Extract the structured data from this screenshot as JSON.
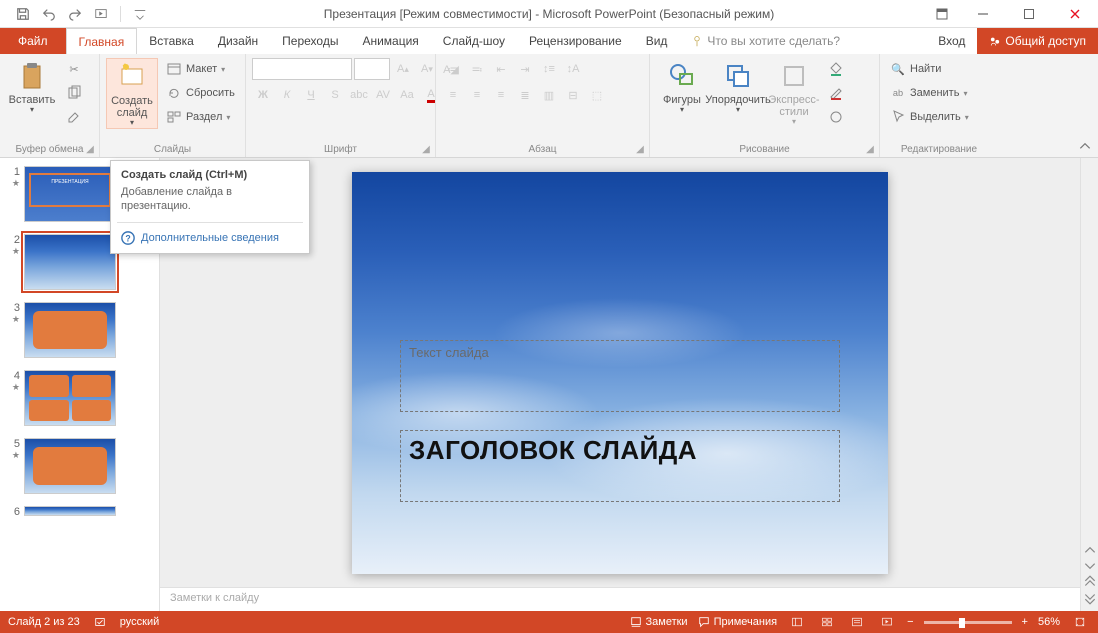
{
  "titlebar": {
    "title": "Презентация [Режим совместимости] - Microsoft PowerPoint (Безопасный режим)"
  },
  "tabs": {
    "file": "Файл",
    "home": "Главная",
    "insert": "Вставка",
    "design": "Дизайн",
    "transitions": "Переходы",
    "animation": "Анимация",
    "slideshow": "Слайд-шоу",
    "review": "Рецензирование",
    "view": "Вид",
    "tell_me": "Что вы хотите сделать?",
    "signin": "Вход",
    "share": "Общий доступ"
  },
  "ribbon": {
    "clipboard": {
      "label": "Буфер обмена",
      "paste": "Вставить"
    },
    "slides": {
      "label": "Слайды",
      "new_slide": "Создать слайд",
      "layout": "Макет",
      "reset": "Сбросить",
      "section": "Раздел"
    },
    "font": {
      "label": "Шрифт"
    },
    "paragraph": {
      "label": "Абзац"
    },
    "drawing": {
      "label": "Рисование",
      "shapes": "Фигуры",
      "arrange": "Упорядочить",
      "quick_styles": "Экспресс-стили"
    },
    "editing": {
      "label": "Редактирование",
      "find": "Найти",
      "replace": "Заменить",
      "select": "Выделить"
    }
  },
  "tooltip": {
    "title": "Создать слайд (Ctrl+M)",
    "body": "Добавление слайда в презентацию.",
    "help": "Дополнительные сведения"
  },
  "thumbnails": {
    "count": 6,
    "selected": 2
  },
  "slide": {
    "subtitle_placeholder": "Текст слайда",
    "title_placeholder": "ЗАГОЛОВОК СЛАЙДА"
  },
  "notes": {
    "placeholder": "Заметки к слайду"
  },
  "statusbar": {
    "counter": "Слайд 2 из 23",
    "language": "русский",
    "notes": "Заметки",
    "comments": "Примечания",
    "zoom": "56%"
  },
  "colors": {
    "accent": "#d24726"
  }
}
